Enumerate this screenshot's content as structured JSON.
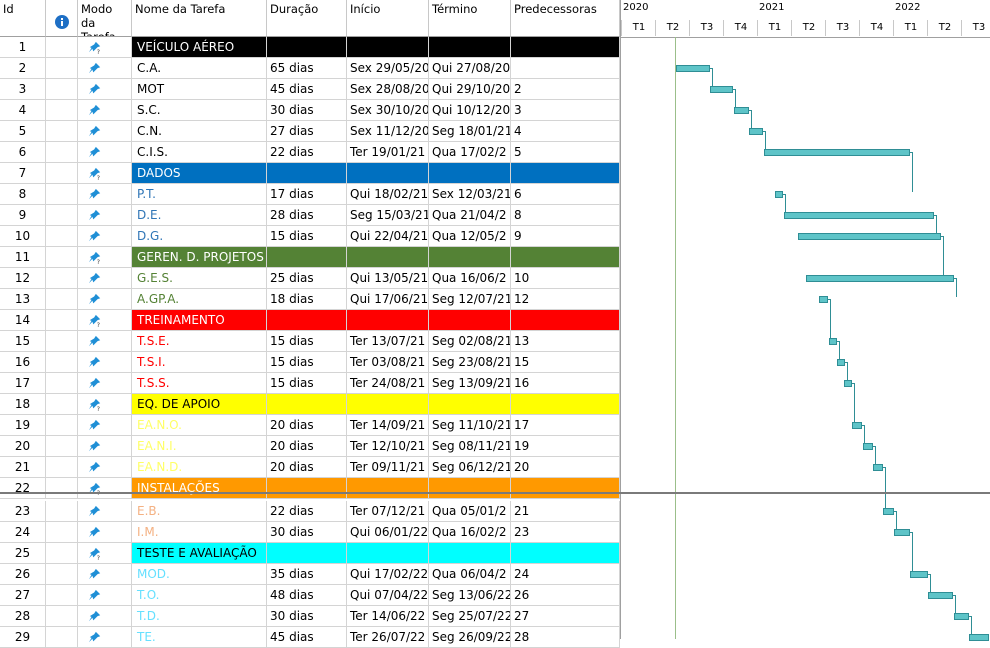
{
  "columns": {
    "id": "Id",
    "mode": "Modo da Tarefa",
    "name": "Nome da Tarefa",
    "duration": "Duração",
    "start": "Início",
    "finish": "Término",
    "predecessors": "Predecessoras"
  },
  "timescale": {
    "years": [
      "2020",
      "2021",
      "2022"
    ],
    "quarters": [
      "T1",
      "T2",
      "T3",
      "T4",
      "T1",
      "T2",
      "T3",
      "T4",
      "T1",
      "T2",
      "T3"
    ]
  },
  "colors": {
    "summary_black": "#000000",
    "summary_blue": "#0070c0",
    "summary_green": "#548235",
    "summary_red": "#ff0000",
    "summary_yellow": "#ffff00",
    "summary_orange": "#ff9900",
    "summary_cyan": "#00ffff",
    "bar": "#5ec4c8"
  },
  "tasks": [
    {
      "id": "1",
      "name": "VEÍCULO AÉREO",
      "summary": true,
      "bg": "#000000",
      "fg": "#ffffff",
      "duration": "",
      "start": "",
      "finish": "",
      "pred": ""
    },
    {
      "id": "2",
      "name": "C.A.",
      "fg": "#000000",
      "duration": "65 dias",
      "start": "Sex 29/05/20",
      "finish": "Qui 27/08/20",
      "pred": ""
    },
    {
      "id": "3",
      "name": "MOT",
      "fg": "#000000",
      "duration": "45 dias",
      "start": "Sex 28/08/20",
      "finish": "Qui 29/10/20",
      "pred": "2"
    },
    {
      "id": "4",
      "name": "S.C.",
      "fg": "#000000",
      "duration": "30 dias",
      "start": "Sex 30/10/20",
      "finish": "Qui 10/12/20",
      "pred": "3"
    },
    {
      "id": "5",
      "name": "C.N.",
      "fg": "#000000",
      "duration": "27 dias",
      "start": "Sex 11/12/20",
      "finish": "Seg 18/01/21",
      "pred": "4"
    },
    {
      "id": "6",
      "name": "C.I.S.",
      "fg": "#000000",
      "duration": "22 dias",
      "start": "Ter 19/01/21",
      "finish": "Qua 17/02/2",
      "pred": "5"
    },
    {
      "id": "7",
      "name": "DADOS",
      "summary": true,
      "bg": "#0070c0",
      "fg": "#ffffff",
      "duration": "",
      "start": "",
      "finish": "",
      "pred": ""
    },
    {
      "id": "8",
      "name": "P.T.",
      "fg": "#2e75b6",
      "duration": "17 dias",
      "start": "Qui 18/02/21",
      "finish": "Sex 12/03/21",
      "pred": "6"
    },
    {
      "id": "9",
      "name": "D.E.",
      "fg": "#2e75b6",
      "duration": "28 dias",
      "start": "Seg 15/03/21",
      "finish": "Qua 21/04/2",
      "pred": "8"
    },
    {
      "id": "10",
      "name": "D.G.",
      "fg": "#2e75b6",
      "duration": "15 dias",
      "start": "Qui 22/04/21",
      "finish": "Qua 12/05/2",
      "pred": "9"
    },
    {
      "id": "11",
      "name": "GEREN. D. PROJETOS",
      "summary": true,
      "bg": "#548235",
      "fg": "#ffffff",
      "duration": "",
      "start": "",
      "finish": "",
      "pred": ""
    },
    {
      "id": "12",
      "name": "G.E.S.",
      "fg": "#548235",
      "duration": "25 dias",
      "start": "Qui 13/05/21",
      "finish": "Qua 16/06/2",
      "pred": "10"
    },
    {
      "id": "13",
      "name": "A.GP.A.",
      "fg": "#548235",
      "duration": "18 dias",
      "start": "Qui 17/06/21",
      "finish": "Seg 12/07/21",
      "pred": "12"
    },
    {
      "id": "14",
      "name": "TREINAMENTO",
      "summary": true,
      "bg": "#ff0000",
      "fg": "#ffffff",
      "duration": "",
      "start": "",
      "finish": "",
      "pred": ""
    },
    {
      "id": "15",
      "name": "T.S.E.",
      "fg": "#ff0000",
      "duration": "15 dias",
      "start": "Ter 13/07/21",
      "finish": "Seg 02/08/21",
      "pred": "13"
    },
    {
      "id": "16",
      "name": "T.S.I.",
      "fg": "#ff0000",
      "duration": "15 dias",
      "start": "Ter 03/08/21",
      "finish": "Seg 23/08/21",
      "pred": "15"
    },
    {
      "id": "17",
      "name": "T.S.S.",
      "fg": "#ff0000",
      "duration": "15 dias",
      "start": "Ter 24/08/21",
      "finish": "Seg 13/09/21",
      "pred": "16"
    },
    {
      "id": "18",
      "name": "EQ. DE APOIO",
      "summary": true,
      "bg": "#ffff00",
      "fg": "#000000",
      "duration": "",
      "start": "",
      "finish": "",
      "pred": ""
    },
    {
      "id": "19",
      "name": "EA.N.O.",
      "fg": "#ffff66",
      "duration": "20 dias",
      "start": "Ter 14/09/21",
      "finish": "Seg 11/10/21",
      "pred": "17"
    },
    {
      "id": "20",
      "name": "EA.N.I.",
      "fg": "#ffff66",
      "duration": "20 dias",
      "start": "Ter 12/10/21",
      "finish": "Seg 08/11/21",
      "pred": "19"
    },
    {
      "id": "21",
      "name": "EA.N.D.",
      "fg": "#ffff66",
      "duration": "20 dias",
      "start": "Ter 09/11/21",
      "finish": "Seg 06/12/21",
      "pred": "20"
    },
    {
      "id": "22",
      "name": "INSTALAÇÕES",
      "summary": true,
      "bg": "#ff9900",
      "fg": "#ffffff",
      "duration": "",
      "start": "",
      "finish": "",
      "pred": ""
    },
    {
      "id": "23",
      "name": "E.B.",
      "fg": "#f4b183",
      "duration": "22 dias",
      "start": "Ter 07/12/21",
      "finish": "Qua 05/01/2",
      "pred": "21"
    },
    {
      "id": "24",
      "name": "I.M.",
      "fg": "#f4b183",
      "duration": "30 dias",
      "start": "Qui 06/01/22",
      "finish": "Qua 16/02/2",
      "pred": "23"
    },
    {
      "id": "25",
      "name": "TESTE E AVALIAÇÃO",
      "summary": true,
      "bg": "#00ffff",
      "fg": "#000000",
      "duration": "",
      "start": "",
      "finish": "",
      "pred": ""
    },
    {
      "id": "26",
      "name": "MOD.",
      "fg": "#66e0ff",
      "duration": "35 dias",
      "start": "Qui 17/02/22",
      "finish": "Qua 06/04/2",
      "pred": "24"
    },
    {
      "id": "27",
      "name": "T.O.",
      "fg": "#66e0ff",
      "duration": "48 dias",
      "start": "Qui 07/04/22",
      "finish": "Seg 13/06/22",
      "pred": "26"
    },
    {
      "id": "28",
      "name": "T.D.",
      "fg": "#66e0ff",
      "duration": "30 dias",
      "start": "Ter 14/06/22",
      "finish": "Seg 25/07/22",
      "pred": "27"
    },
    {
      "id": "29",
      "name": "TE.",
      "fg": "#66e0ff",
      "duration": "45 dias",
      "start": "Ter 26/07/22",
      "finish": "Seg 26/09/22",
      "pred": "28"
    }
  ]
}
